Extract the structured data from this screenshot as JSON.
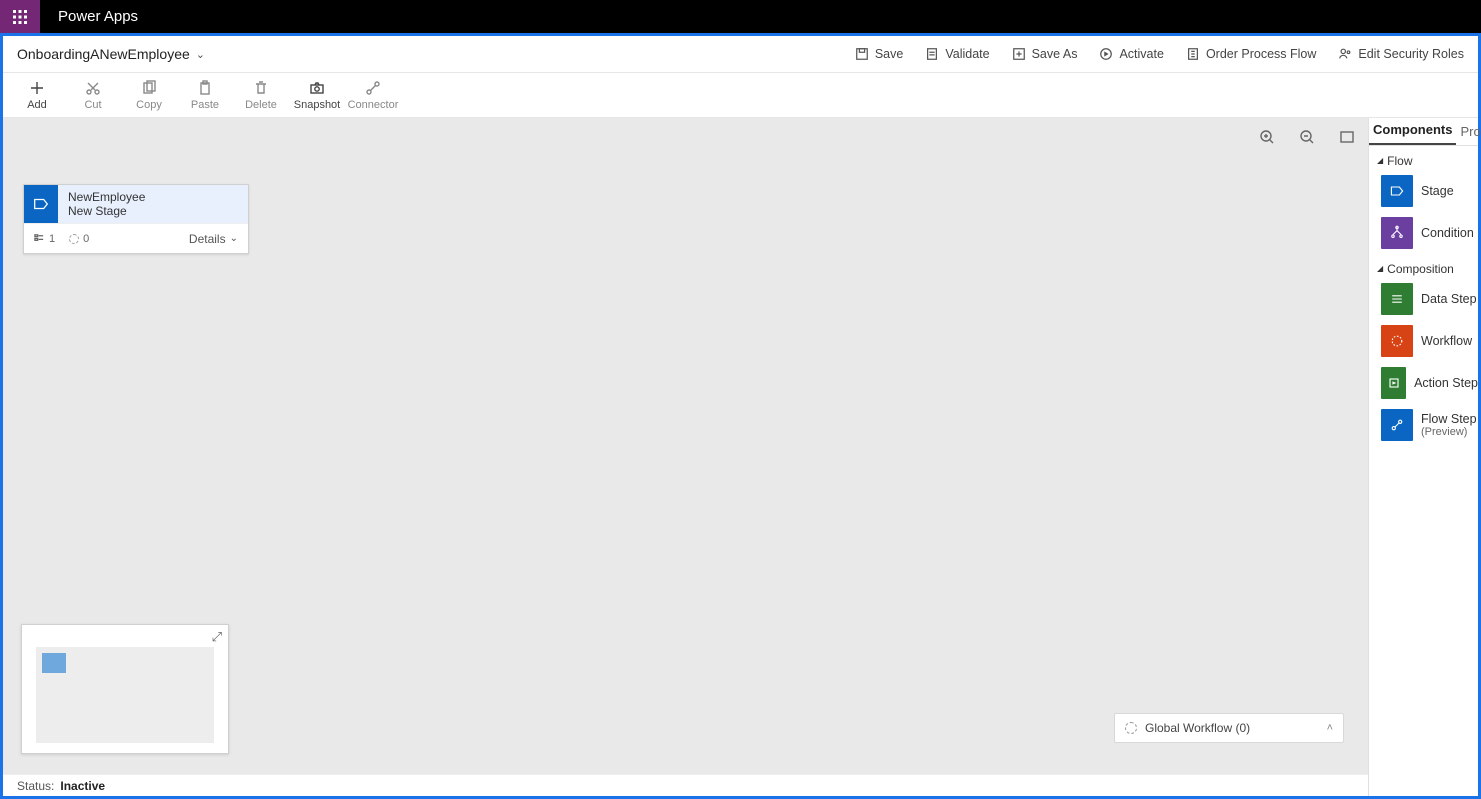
{
  "app": {
    "brand": "Power Apps"
  },
  "title": "OnboardingANewEmployee",
  "commands": {
    "save": "Save",
    "validate": "Validate",
    "save_as": "Save As",
    "activate": "Activate",
    "order": "Order Process Flow",
    "security": "Edit Security Roles"
  },
  "ribbon": {
    "add": "Add",
    "cut": "Cut",
    "copy": "Copy",
    "paste": "Paste",
    "delete": "Delete",
    "snapshot": "Snapshot",
    "connector": "Connector"
  },
  "stage": {
    "entity": "NewEmployee",
    "name": "New Stage",
    "steps": "1",
    "workflows": "0",
    "details": "Details"
  },
  "global_workflow": "Global Workflow (0)",
  "status": {
    "label": "Status:",
    "value": "Inactive"
  },
  "panel": {
    "tabs": {
      "components": "Components",
      "properties": "Pro"
    },
    "groups": {
      "flow": "Flow",
      "composition": "Composition"
    },
    "items": {
      "stage": "Stage",
      "condition": "Condition",
      "data_step": "Data Step",
      "workflow": "Workflow",
      "action_step": "Action Step",
      "flow_step": "Flow Step",
      "flow_step_sub": "(Preview)"
    }
  }
}
